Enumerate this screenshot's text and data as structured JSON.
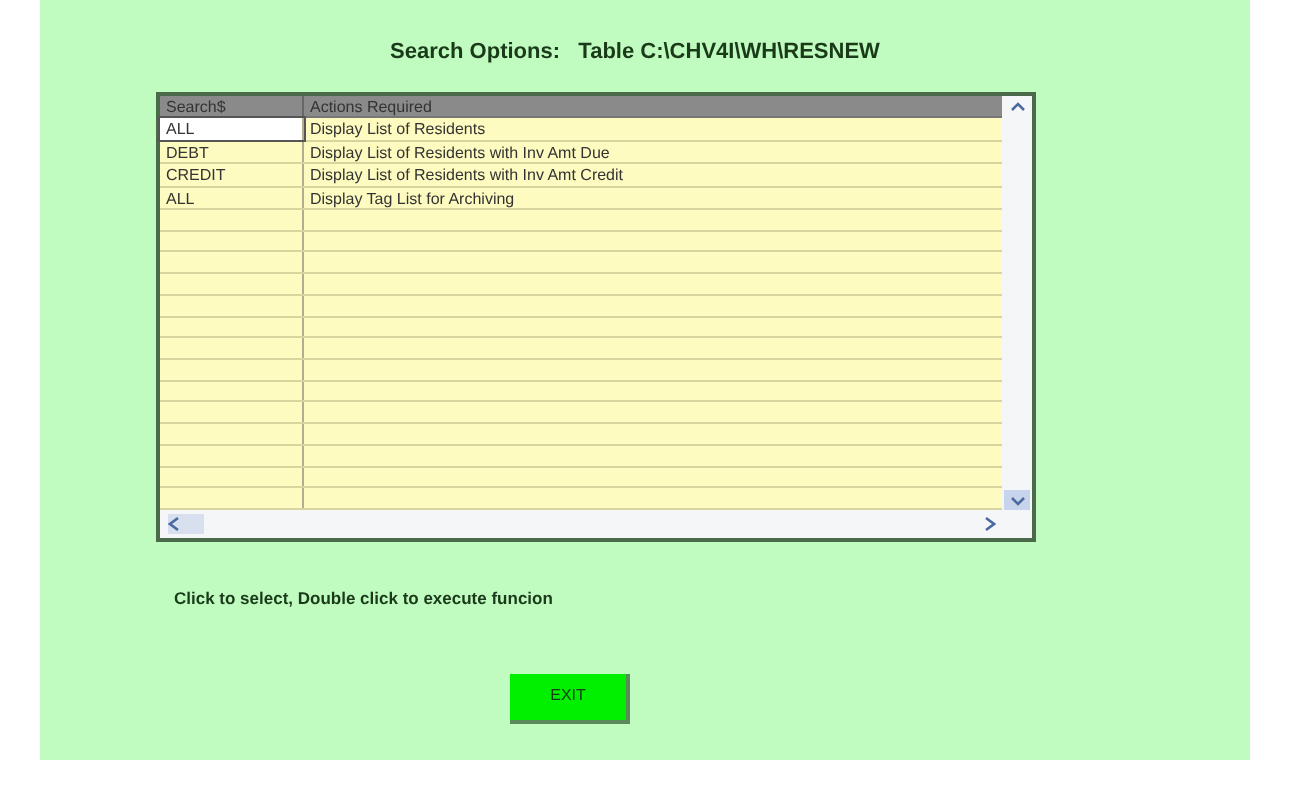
{
  "title": "Search Options:   Table C:\\CHV4I\\WH\\RESNEW",
  "table": {
    "columns": [
      "Search$",
      "Actions Required"
    ],
    "rows": [
      {
        "cells": [
          "ALL",
          "Display List of Residents"
        ],
        "selected": true
      },
      {
        "cells": [
          "DEBT",
          "Display List of Residents with Inv Amt Due"
        ],
        "selected": false
      },
      {
        "cells": [
          "CREDIT",
          "Display List of Residents with Inv Amt Credit"
        ],
        "selected": false
      },
      {
        "cells": [
          "ALL",
          "Display Tag List for Archiving"
        ],
        "selected": false
      }
    ]
  },
  "hint": "Click to select, Double click to execute funcion",
  "exit_button": "EXIT"
}
